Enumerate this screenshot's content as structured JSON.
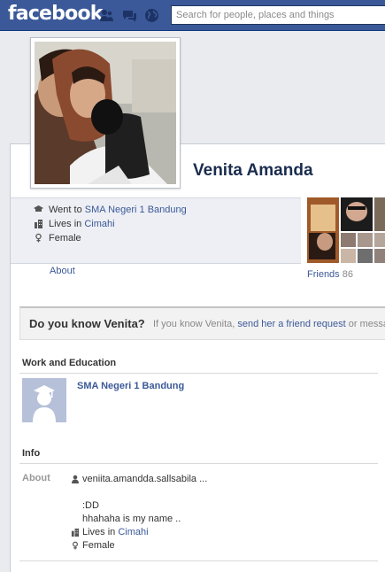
{
  "header": {
    "logo": "facebook",
    "search_placeholder": "Search for people, places and things"
  },
  "profile": {
    "name": "Venita Amanda",
    "facts": [
      {
        "prefix": "Went to ",
        "link": "SMA Negeri 1 Bandung"
      },
      {
        "prefix": "Lives in ",
        "link": "Cimahi"
      },
      {
        "prefix": "",
        "text": "Female"
      }
    ],
    "about_link": "About",
    "friends_label": "Friends",
    "friends_count": "86"
  },
  "know_box": {
    "title": "Do you know Venita?",
    "text_before": "If you know Venita, ",
    "link": "send her a friend request",
    "text_after": " or messa"
  },
  "work_education": {
    "heading": "Work and Education",
    "school": "SMA Negeri 1 Bandung"
  },
  "info": {
    "heading": "Info",
    "label": "About",
    "username": "veniita.amandda.sallsabila ...",
    "bio_line1": ":DD",
    "bio_line2": "hhahaha is my name ..",
    "lives_prefix": "Lives in ",
    "lives_link": "Cimahi",
    "gender": "Female"
  },
  "colors": {
    "brand": "#3b5998",
    "link": "#3b5998"
  },
  "icons": [
    "friends-icon",
    "messages-icon",
    "globe-icon",
    "school-icon",
    "home-icon",
    "gender-icon",
    "person-icon"
  ]
}
